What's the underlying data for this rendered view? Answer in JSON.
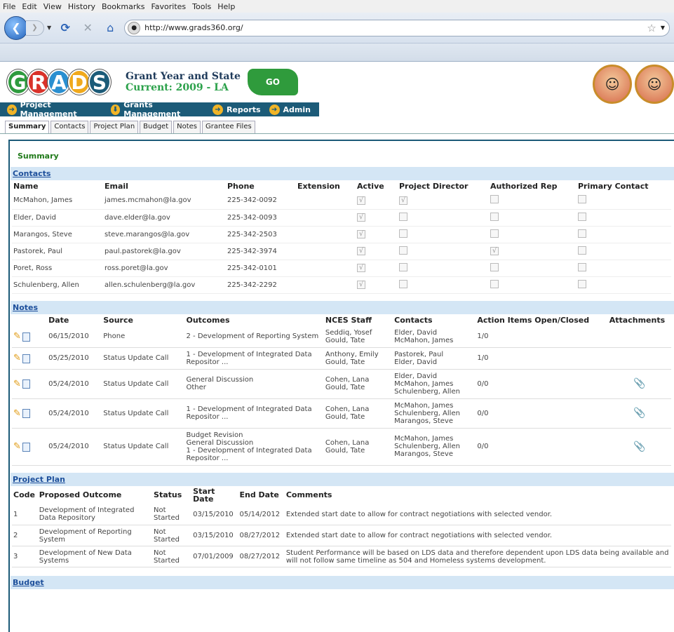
{
  "browser": {
    "menu": [
      "File",
      "Edit",
      "View",
      "History",
      "Bookmarks",
      "Favorites",
      "Tools",
      "Help"
    ],
    "url": "http://www.grads360.org/"
  },
  "header": {
    "logo_letters": [
      "G",
      "R",
      "A",
      "D",
      "S"
    ],
    "logo_colors": [
      "#2e9b3e",
      "#d9322a",
      "#2a8fd0",
      "#f0a91c",
      "#1c5b78"
    ],
    "grant_year_title": "Grant Year and State",
    "grant_year_current": "Current: 2009 - LA",
    "go_label": "GO"
  },
  "mainnav": [
    "Project Management",
    "Grants Management",
    "Reports",
    "Admin"
  ],
  "tabs": [
    "Summary",
    "Contacts",
    "Project Plan",
    "Budget",
    "Notes",
    "Grantee Files"
  ],
  "summary_title": "Summary",
  "contacts": {
    "title": "Contacts",
    "headers": [
      "Name",
      "Email",
      "Phone",
      "Extension",
      "Active",
      "Project Director",
      "Authorized Rep",
      "Primary Contact"
    ],
    "rows": [
      {
        "name": "McMahon, James",
        "email": "james.mcmahon@la.gov",
        "phone": "225-342-0092",
        "active": true,
        "director": true,
        "authrep": false,
        "primary": false
      },
      {
        "name": "Elder, David",
        "email": "dave.elder@la.gov",
        "phone": "225-342-0093",
        "active": true,
        "director": false,
        "authrep": false,
        "primary": false
      },
      {
        "name": "Marangos, Steve",
        "email": "steve.marangos@la.gov",
        "phone": "225-342-2503",
        "active": true,
        "director": false,
        "authrep": false,
        "primary": false
      },
      {
        "name": "Pastorek, Paul",
        "email": "paul.pastorek@la.gov",
        "phone": "225-342-3974",
        "active": true,
        "director": false,
        "authrep": true,
        "primary": false
      },
      {
        "name": "Poret, Ross",
        "email": "ross.poret@la.gov",
        "phone": "225-342-0101",
        "active": true,
        "director": false,
        "authrep": false,
        "primary": false
      },
      {
        "name": "Schulenberg, Allen",
        "email": "allen.schulenberg@la.gov",
        "phone": "225-342-2292",
        "active": true,
        "director": false,
        "authrep": false,
        "primary": false
      }
    ]
  },
  "notes": {
    "title": "Notes",
    "headers": [
      "Date",
      "Source",
      "Outcomes",
      "NCES Staff",
      "Contacts",
      "Action Items Open/Closed",
      "Attachments"
    ],
    "rows": [
      {
        "date": "06/15/2010",
        "source": "Phone",
        "outcomes": [
          "2 - Development of Reporting System"
        ],
        "staff": [
          "Seddiq, Yosef",
          "Gould, Tate"
        ],
        "contacts": [
          "Elder, David",
          "McMahon, James"
        ],
        "actions": "1/0",
        "attachment": false
      },
      {
        "date": "05/25/2010",
        "source": "Status Update Call",
        "outcomes": [
          "1 - Development of Integrated Data",
          "Repositor ..."
        ],
        "staff": [
          "Anthony, Emily",
          "Gould, Tate"
        ],
        "contacts": [
          "Pastorek, Paul",
          "Elder, David"
        ],
        "actions": "1/0",
        "attachment": false
      },
      {
        "date": "05/24/2010",
        "source": "Status Update Call",
        "outcomes": [
          "General Discussion",
          "Other"
        ],
        "staff": [
          "Cohen, Lana",
          "Gould, Tate"
        ],
        "contacts": [
          "Elder, David",
          "McMahon, James",
          "Schulenberg, Allen"
        ],
        "actions": "0/0",
        "attachment": true
      },
      {
        "date": "05/24/2010",
        "source": "Status Update Call",
        "outcomes": [
          "1 - Development of Integrated Data",
          "Repositor ..."
        ],
        "staff": [
          "Cohen, Lana",
          "Gould, Tate"
        ],
        "contacts": [
          "McMahon, James",
          "Schulenberg, Allen",
          "Marangos, Steve"
        ],
        "actions": "0/0",
        "attachment": true
      },
      {
        "date": "05/24/2010",
        "source": "Status Update Call",
        "outcomes": [
          "Budget Revision",
          "General Discussion",
          "1 - Development of Integrated Data",
          "Repositor ..."
        ],
        "staff": [
          "Cohen, Lana",
          "Gould, Tate"
        ],
        "contacts": [
          "McMahon, James",
          "Schulenberg, Allen",
          "Marangos, Steve"
        ],
        "actions": "0/0",
        "attachment": true
      }
    ]
  },
  "project_plan": {
    "title": "Project Plan",
    "headers": [
      "Code",
      "Proposed Outcome",
      "Status",
      "Start Date",
      "End Date",
      "Comments"
    ],
    "rows": [
      {
        "code": "1",
        "outcome": "Development of Integrated Data Repository",
        "status": "Not Started",
        "start": "03/15/2010",
        "end": "05/14/2012",
        "comments": "Extended start date to allow for contract negotiations with selected vendor."
      },
      {
        "code": "2",
        "outcome": "Development of Reporting System",
        "status": "Not Started",
        "start": "03/15/2010",
        "end": "08/27/2012",
        "comments": "Extended start date to allow for contract negotiations with selected vendor."
      },
      {
        "code": "3",
        "outcome": "Development of New Data Systems",
        "status": "Not Started",
        "start": "07/01/2009",
        "end": "08/27/2012",
        "comments": "Student Performance will be based on LDS data and therefore dependent upon LDS data being available and will not follow same timeline as 504 and Homeless systems development."
      }
    ]
  },
  "budget": {
    "title": "Budget"
  }
}
